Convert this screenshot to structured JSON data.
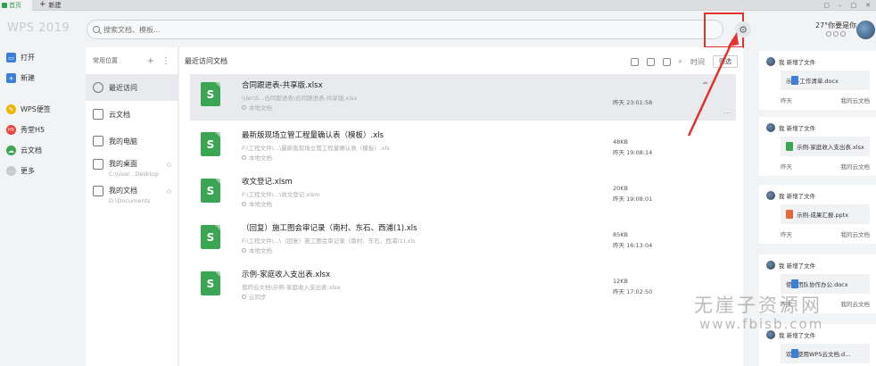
{
  "tabs": {
    "home": "首页",
    "new": "新建"
  },
  "header": {
    "app_title": "WPS 2019",
    "search_placeholder": "搜索文档、模板...",
    "user_name": "27°你要是你"
  },
  "sidebar": {
    "items": [
      {
        "label": "打开",
        "icon": "folder-icon",
        "color": "#3b7fd8"
      },
      {
        "label": "新建",
        "icon": "plus-icon",
        "color": "#3b7fd8"
      },
      {
        "label": "WPS便签",
        "icon": "note-icon",
        "color": "#f0b400"
      },
      {
        "label": "秀堂H5",
        "icon": "h5-icon",
        "color": "#e9463d"
      },
      {
        "label": "云文档",
        "icon": "cloud-icon",
        "color": "#3aa552"
      },
      {
        "label": "更多",
        "icon": "more-icon",
        "color": "#c7c9cd"
      }
    ]
  },
  "locations": {
    "title": "常用位置",
    "items": [
      {
        "label": "最近访问",
        "active": true
      },
      {
        "label": "云文档"
      },
      {
        "label": "我的电脑"
      },
      {
        "label": "我的桌面",
        "sub": "C:\\User...Desktop"
      },
      {
        "label": "我的文档",
        "sub": "D:\\Documents"
      }
    ]
  },
  "main": {
    "title": "最近访问文档",
    "tool_time": "时间",
    "tool_filter": "筛选",
    "docs": [
      {
        "name": "合同跟进表-共享版.xlsx",
        "path": "\\\\ler\\S...合同跟进表\\合同跟进表-共享版.xlsx",
        "loc": "本地文档",
        "size": "",
        "time": "昨天 23:01:58",
        "active": true
      },
      {
        "name": "最新版现场立管工程量确认表（模板）.xls",
        "path": "F:\\工程文件\\...\\最新版现场立管工程量确认表（模板）.xls",
        "loc": "本地文档",
        "size": "48KB",
        "time": "昨天 19:08:14"
      },
      {
        "name": "收文登记.xlsm",
        "path": "F:\\工程文件\\...\\收文登记.xlsm",
        "loc": "本地文档",
        "size": "20KB",
        "time": "昨天 19:08:01"
      },
      {
        "name": "（回复）施工图会审记录（南村、东石、西浦(1).xls",
        "path": "F:\\工程文件\\...\\（回复）施工图会审记录（南村、东石、西浦(1).xls",
        "loc": "本地文档",
        "size": "85KB",
        "time": "昨天 16:13:04"
      },
      {
        "name": "示例-家庭收入支出表.xlsx",
        "path": "我的云文档\\示例-家庭收入支出表.xlsx",
        "loc": "云同步",
        "size": "12KB",
        "time": "昨天 17:02:50"
      }
    ]
  },
  "feed": {
    "cards": [
      {
        "action": "我 新增了文件",
        "file": "示例-工作清单.docx",
        "ftype": "doc",
        "when": "昨天",
        "where": "我的云文档"
      },
      {
        "action": "我 新增了文件",
        "file": "示例-家庭收入支出表.xlsx",
        "ftype": "xls",
        "when": "昨天",
        "where": "我的云文档"
      },
      {
        "action": "我 新增了文件",
        "file": "示例-成果汇报.pptx",
        "ftype": "ppt",
        "when": "昨天",
        "where": "我的云文档"
      },
      {
        "action": "我 新增了文件",
        "file": "使用团队协作办公.docx",
        "ftype": "doc",
        "when": "昨天",
        "where": "我的云文档"
      },
      {
        "action": "我 新增了文件",
        "file": "欢迎使用WPS云文档.d...",
        "ftype": "doc",
        "when": "",
        "where": ""
      }
    ]
  },
  "watermark": {
    "line1": "无崖子资源网",
    "line2": "www.fbisb.com"
  }
}
